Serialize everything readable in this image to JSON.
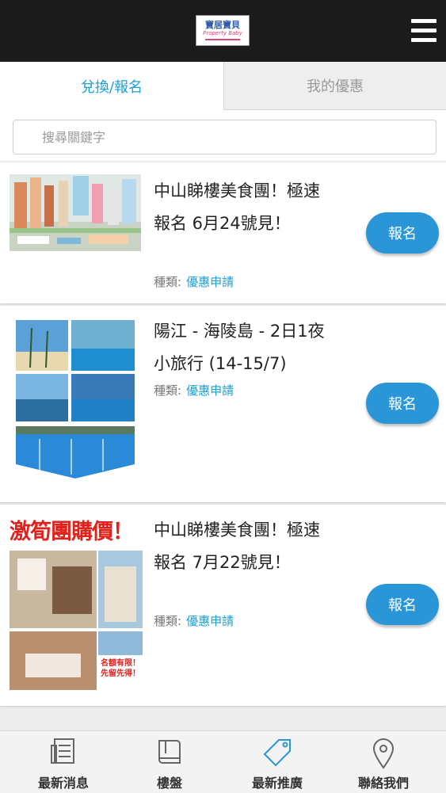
{
  "app": {
    "logo_text": "寶居寶貝",
    "logo_subtext": "Property Baby"
  },
  "header": {
    "menu_icon": "hamburger-icon"
  },
  "tabs": [
    {
      "label": "兌換/報名",
      "active": true
    },
    {
      "label": "我的優惠",
      "active": false
    }
  ],
  "search": {
    "placeholder": "搜尋關鍵字",
    "value": ""
  },
  "items": [
    {
      "title": "中山睇樓美食團！極速報名 6月24號見！",
      "type_label": "種類:",
      "type_value": "優惠申請",
      "button": "報名",
      "image": "city-development-model"
    },
    {
      "title": "陽江 - 海陵島 - 2日1夜小旅行 (14-15/7)",
      "type_label": "種類:",
      "type_value": "優惠申請",
      "button": "報名",
      "image": "beach-resort-collage"
    },
    {
      "title": "中山睇樓美食團！極速報名 7月22號見！",
      "type_label": "種類:",
      "type_value": "優惠申請",
      "button": "報名",
      "image": "apartment-promo-poster",
      "image_text": "激筍團購價！",
      "image_badge": "名額有限！先留先得！"
    }
  ],
  "bottom_nav": [
    {
      "label": "最新消息",
      "icon": "newspaper-icon"
    },
    {
      "label": "樓盤",
      "icon": "book-icon"
    },
    {
      "label": "最新推廣",
      "icon": "tag-icon",
      "active": true
    },
    {
      "label": "聯絡我們",
      "icon": "location-pin-icon"
    }
  ],
  "colors": {
    "accent": "#1aa0d8",
    "button": "#2a96d8",
    "topbar": "#1b1b1b"
  }
}
